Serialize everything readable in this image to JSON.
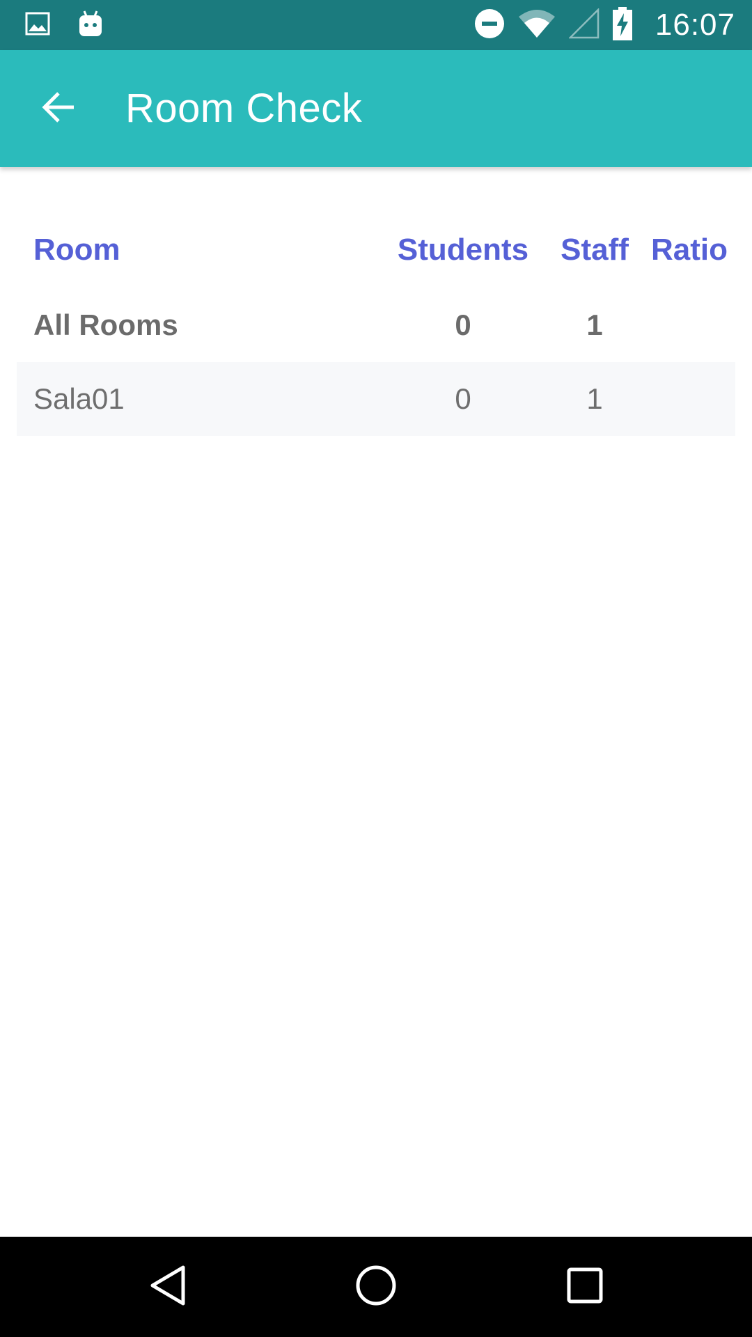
{
  "status_bar": {
    "time": "16:07",
    "icons_left": [
      "image-icon",
      "android-icon"
    ],
    "icons_right": [
      "do-not-disturb-icon",
      "wifi-icon",
      "cell-signal-icon",
      "battery-charging-icon"
    ]
  },
  "app_bar": {
    "title": "Room Check",
    "back_icon": "arrow-back-icon"
  },
  "table": {
    "headers": {
      "room": "Room",
      "students": "Students",
      "staff": "Staff",
      "ratio": "Ratio"
    },
    "summary": {
      "room": "All Rooms",
      "students": "0",
      "staff": "1",
      "ratio": ""
    },
    "rows": [
      {
        "room": "Sala01",
        "students": "0",
        "staff": "1",
        "ratio": ""
      }
    ]
  },
  "nav_bar": {
    "buttons": [
      "back-triangle-icon",
      "home-circle-icon",
      "recents-square-icon"
    ]
  },
  "colors": {
    "status_bar": "#1b7b7e",
    "app_bar": "#2bbbbb",
    "header_text": "#5560d6",
    "body_text": "#6e6e6e",
    "alt_row": "#f7f8fa"
  }
}
